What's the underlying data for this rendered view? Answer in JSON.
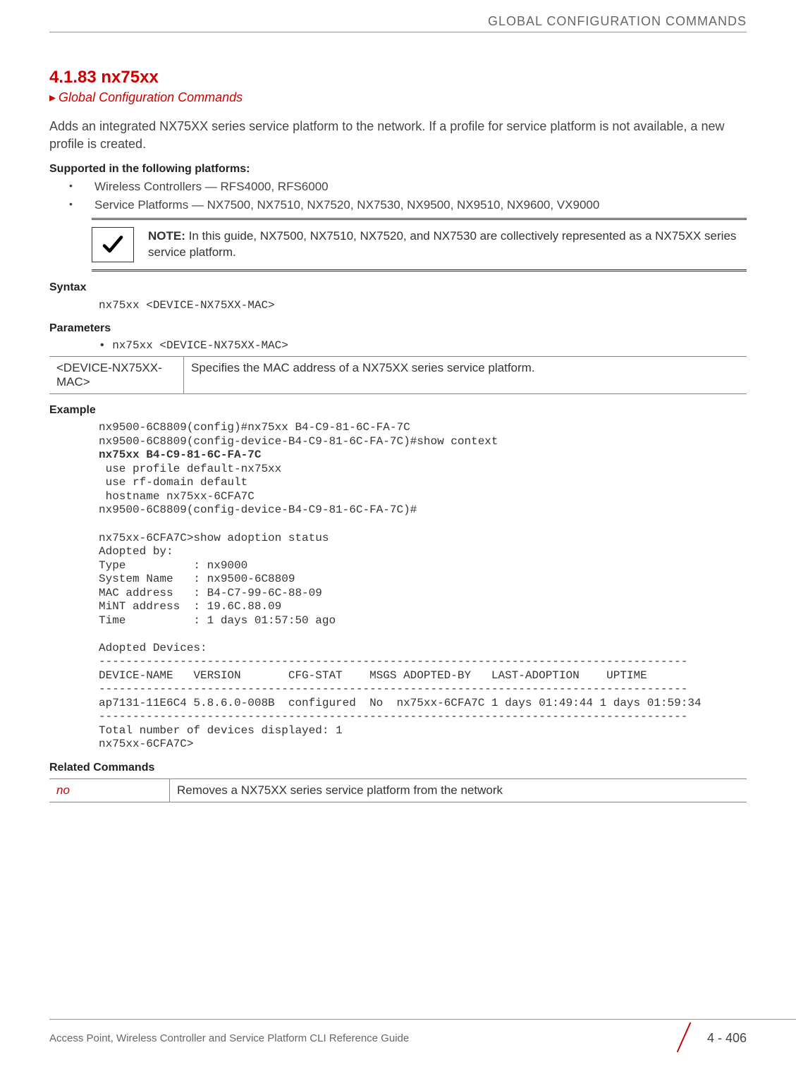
{
  "header": {
    "section_label": "GLOBAL CONFIGURATION COMMANDS"
  },
  "section": {
    "number_title": "4.1.83 nx75xx",
    "breadcrumb": "Global Configuration Commands",
    "intro": "Adds an integrated NX75XX series service platform to the network. If a profile for service platform is not available, a new profile is created."
  },
  "supported": {
    "heading": "Supported in the following platforms:",
    "items": [
      "Wireless Controllers — RFS4000, RFS6000",
      "Service Platforms — NX7500, NX7510, NX7520, NX7530, NX9500, NX9510, NX9600, VX9000"
    ]
  },
  "note": {
    "label": "NOTE:",
    "text": " In this guide, NX7500, NX7510, NX7520, and NX7530 are collectively represented as a NX75XX series service platform."
  },
  "syntax": {
    "heading": "Syntax",
    "code": "nx75xx <DEVICE-NX75XX-MAC>"
  },
  "parameters": {
    "heading": "Parameters",
    "bullet": "• nx75xx <DEVICE-NX75XX-MAC>",
    "table": {
      "left": "<DEVICE-NX75XX-MAC>",
      "right": "Specifies the MAC address of a NX75XX series service platform."
    }
  },
  "example": {
    "heading": "Example",
    "line1": "nx9500-6C8809(config)#nx75xx B4-C9-81-6C-FA-7C",
    "line2": "nx9500-6C8809(config-device-B4-C9-81-6C-FA-7C)#show context",
    "line3_bold": "nx75xx B4-C9-81-6C-FA-7C",
    "line4": " use profile default-nx75xx",
    "line5": " use rf-domain default",
    "line6": " hostname nx75xx-6CFA7C",
    "line7": "nx9500-6C8809(config-device-B4-C9-81-6C-FA-7C)#",
    "blank1": "",
    "line8": "nx75xx-6CFA7C>show adoption status",
    "line9": "Adopted by:",
    "line10": "Type          : nx9000",
    "line11": "System Name   : nx9500-6C8809",
    "line12": "MAC address   : B4-C7-99-6C-88-09",
    "line13": "MiNT address  : 19.6C.88.09",
    "line14": "Time          : 1 days 01:57:50 ago",
    "blank2": "",
    "line15": "Adopted Devices:",
    "line16": "---------------------------------------------------------------------------------------",
    "line17": "DEVICE-NAME   VERSION       CFG-STAT    MSGS ADOPTED-BY   LAST-ADOPTION    UPTIME",
    "line18": "---------------------------------------------------------------------------------------",
    "line19": "ap7131-11E6C4 5.8.6.0-008B  configured  No  nx75xx-6CFA7C 1 days 01:49:44 1 days 01:59:34",
    "line20": "---------------------------------------------------------------------------------------",
    "line21": "Total number of devices displayed: 1",
    "line22": "nx75xx-6CFA7C>"
  },
  "related": {
    "heading": "Related Commands",
    "table": {
      "left": "no",
      "right": "Removes a NX75XX series service platform from the network"
    }
  },
  "footer": {
    "title": "Access Point, Wireless Controller and Service Platform CLI Reference Guide",
    "page": "4 - 406"
  }
}
